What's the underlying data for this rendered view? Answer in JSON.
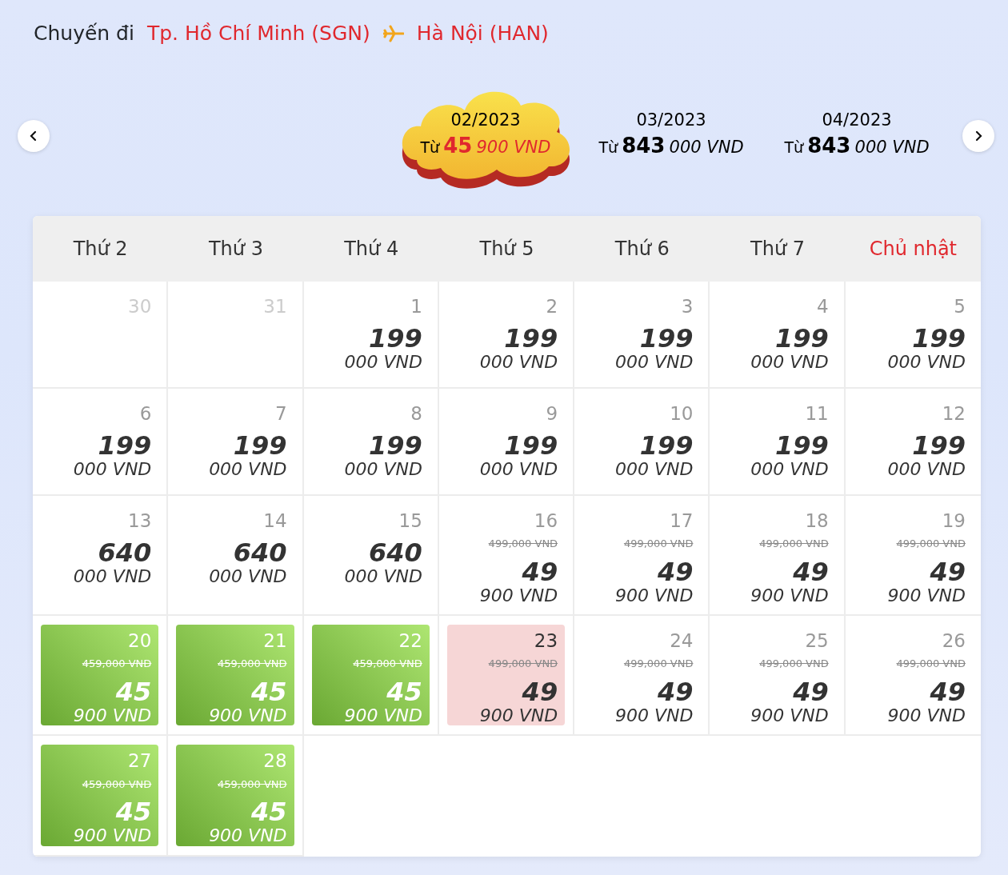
{
  "trip": {
    "label": "Chuyến đi",
    "origin": "Tp. Hồ Chí Minh (SGN)",
    "destination": "Hà Nội (HAN)"
  },
  "months": [
    {
      "label": "02/2023",
      "from": "Từ",
      "price_main": "45",
      "price_rest": "900 VND",
      "selected": true
    },
    {
      "label": "03/2023",
      "from": "Từ",
      "price_main": "843",
      "price_rest": "000 VND",
      "selected": false
    },
    {
      "label": "04/2023",
      "from": "Từ",
      "price_main": "843",
      "price_rest": "000 VND",
      "selected": false
    }
  ],
  "weekdays": [
    {
      "label": "Thứ 2",
      "sunday": false
    },
    {
      "label": "Thứ 3",
      "sunday": false
    },
    {
      "label": "Thứ 4",
      "sunday": false
    },
    {
      "label": "Thứ 5",
      "sunday": false
    },
    {
      "label": "Thứ 6",
      "sunday": false
    },
    {
      "label": "Thứ 7",
      "sunday": false
    },
    {
      "label": "Chủ nhật",
      "sunday": true
    }
  ],
  "days": [
    {
      "day": "30",
      "in_month": false,
      "cheapest": false,
      "selected": false
    },
    {
      "day": "31",
      "in_month": false,
      "cheapest": false,
      "selected": false
    },
    {
      "day": "1",
      "in_month": true,
      "cheapest": false,
      "selected": false,
      "price_main": "199",
      "price_rest": "000 VND"
    },
    {
      "day": "2",
      "in_month": true,
      "cheapest": false,
      "selected": false,
      "price_main": "199",
      "price_rest": "000 VND"
    },
    {
      "day": "3",
      "in_month": true,
      "cheapest": false,
      "selected": false,
      "price_main": "199",
      "price_rest": "000 VND"
    },
    {
      "day": "4",
      "in_month": true,
      "cheapest": false,
      "selected": false,
      "price_main": "199",
      "price_rest": "000 VND"
    },
    {
      "day": "5",
      "in_month": true,
      "cheapest": false,
      "selected": false,
      "price_main": "199",
      "price_rest": "000 VND"
    },
    {
      "day": "6",
      "in_month": true,
      "cheapest": false,
      "selected": false,
      "price_main": "199",
      "price_rest": "000 VND"
    },
    {
      "day": "7",
      "in_month": true,
      "cheapest": false,
      "selected": false,
      "price_main": "199",
      "price_rest": "000 VND"
    },
    {
      "day": "8",
      "in_month": true,
      "cheapest": false,
      "selected": false,
      "price_main": "199",
      "price_rest": "000 VND"
    },
    {
      "day": "9",
      "in_month": true,
      "cheapest": false,
      "selected": false,
      "price_main": "199",
      "price_rest": "000 VND"
    },
    {
      "day": "10",
      "in_month": true,
      "cheapest": false,
      "selected": false,
      "price_main": "199",
      "price_rest": "000 VND"
    },
    {
      "day": "11",
      "in_month": true,
      "cheapest": false,
      "selected": false,
      "price_main": "199",
      "price_rest": "000 VND"
    },
    {
      "day": "12",
      "in_month": true,
      "cheapest": false,
      "selected": false,
      "price_main": "199",
      "price_rest": "000 VND"
    },
    {
      "day": "13",
      "in_month": true,
      "cheapest": false,
      "selected": false,
      "price_main": "640",
      "price_rest": "000 VND"
    },
    {
      "day": "14",
      "in_month": true,
      "cheapest": false,
      "selected": false,
      "price_main": "640",
      "price_rest": "000 VND"
    },
    {
      "day": "15",
      "in_month": true,
      "cheapest": false,
      "selected": false,
      "price_main": "640",
      "price_rest": "000 VND"
    },
    {
      "day": "16",
      "in_month": true,
      "cheapest": false,
      "selected": false,
      "old_price": "499,000 VND",
      "price_main": "49",
      "price_rest": "900 VND"
    },
    {
      "day": "17",
      "in_month": true,
      "cheapest": false,
      "selected": false,
      "old_price": "499,000 VND",
      "price_main": "49",
      "price_rest": "900 VND"
    },
    {
      "day": "18",
      "in_month": true,
      "cheapest": false,
      "selected": false,
      "old_price": "499,000 VND",
      "price_main": "49",
      "price_rest": "900 VND"
    },
    {
      "day": "19",
      "in_month": true,
      "cheapest": false,
      "selected": false,
      "old_price": "499,000 VND",
      "price_main": "49",
      "price_rest": "900 VND"
    },
    {
      "day": "20",
      "in_month": true,
      "cheapest": true,
      "selected": false,
      "old_price": "459,000 VND",
      "price_main": "45",
      "price_rest": "900 VND"
    },
    {
      "day": "21",
      "in_month": true,
      "cheapest": true,
      "selected": false,
      "old_price": "459,000 VND",
      "price_main": "45",
      "price_rest": "900 VND"
    },
    {
      "day": "22",
      "in_month": true,
      "cheapest": true,
      "selected": false,
      "old_price": "459,000 VND",
      "price_main": "45",
      "price_rest": "900 VND"
    },
    {
      "day": "23",
      "in_month": true,
      "cheapest": false,
      "selected": true,
      "old_price": "499,000 VND",
      "price_main": "49",
      "price_rest": "900 VND"
    },
    {
      "day": "24",
      "in_month": true,
      "cheapest": false,
      "selected": false,
      "old_price": "499,000 VND",
      "price_main": "49",
      "price_rest": "900 VND"
    },
    {
      "day": "25",
      "in_month": true,
      "cheapest": false,
      "selected": false,
      "old_price": "499,000 VND",
      "price_main": "49",
      "price_rest": "900 VND"
    },
    {
      "day": "26",
      "in_month": true,
      "cheapest": false,
      "selected": false,
      "old_price": "499,000 VND",
      "price_main": "49",
      "price_rest": "900 VND"
    },
    {
      "day": "27",
      "in_month": true,
      "cheapest": true,
      "selected": false,
      "old_price": "459,000 VND",
      "price_main": "45",
      "price_rest": "900 VND"
    },
    {
      "day": "28",
      "in_month": true,
      "cheapest": true,
      "selected": false,
      "old_price": "459,000 VND",
      "price_main": "45",
      "price_rest": "900 VND"
    }
  ]
}
